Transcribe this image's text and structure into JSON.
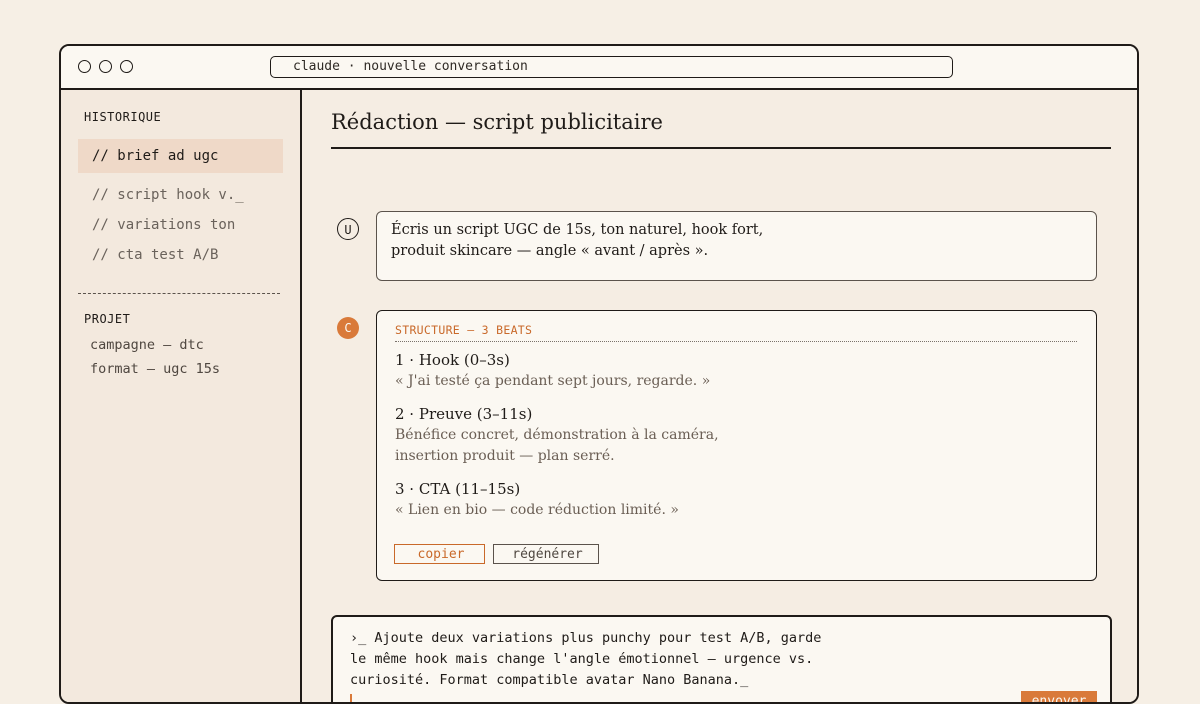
{
  "window": {
    "url": "claude · nouvelle conversation"
  },
  "sidebar": {
    "history_heading": "HISTORIQUE",
    "items": [
      {
        "label": "// brief ad ugc",
        "active": true
      },
      {
        "label": "// script hook v._"
      },
      {
        "label": "// variations ton"
      },
      {
        "label": "// cta test A/B"
      }
    ],
    "project_heading": "PROJET",
    "project_items": [
      {
        "label": "campagne — dtc"
      },
      {
        "label": "format — ugc 15s"
      }
    ]
  },
  "main": {
    "title": "Rédaction — script publicitaire",
    "user_avatar": "U",
    "user_message_lines": [
      "Écris un script UGC de 15s, ton naturel, hook fort,",
      "produit skincare — angle « avant / après »."
    ],
    "assistant_avatar": "C",
    "structure_label": "STRUCTURE — 3 BEATS",
    "beats": [
      {
        "title": "1 · Hook (0–3s)",
        "body": [
          "« J'ai testé ça pendant sept jours, regarde. »"
        ]
      },
      {
        "title": "2 · Preuve (3–11s)",
        "body": [
          "Bénéfice concret, démonstration à la caméra,",
          "insertion produit — plan serré."
        ]
      },
      {
        "title": "3 · CTA (11–15s)",
        "body": [
          "« Lien en bio — code réduction limité. »"
        ]
      }
    ],
    "copy_label": "copier",
    "regenerate_label": "régénérer"
  },
  "composer": {
    "lines": [
      "›_ Ajoute deux variations plus punchy pour test A/B, garde",
      "le même hook mais change l'angle émotionnel — urgence vs.",
      "curiosité. Format compatible avatar Nano Banana._"
    ],
    "send_label": "envoyer"
  },
  "colors": {
    "accent": "#d97a3a",
    "border": "#1f1b18",
    "background": "#f6efe5",
    "active_item": "#efd9c8"
  }
}
